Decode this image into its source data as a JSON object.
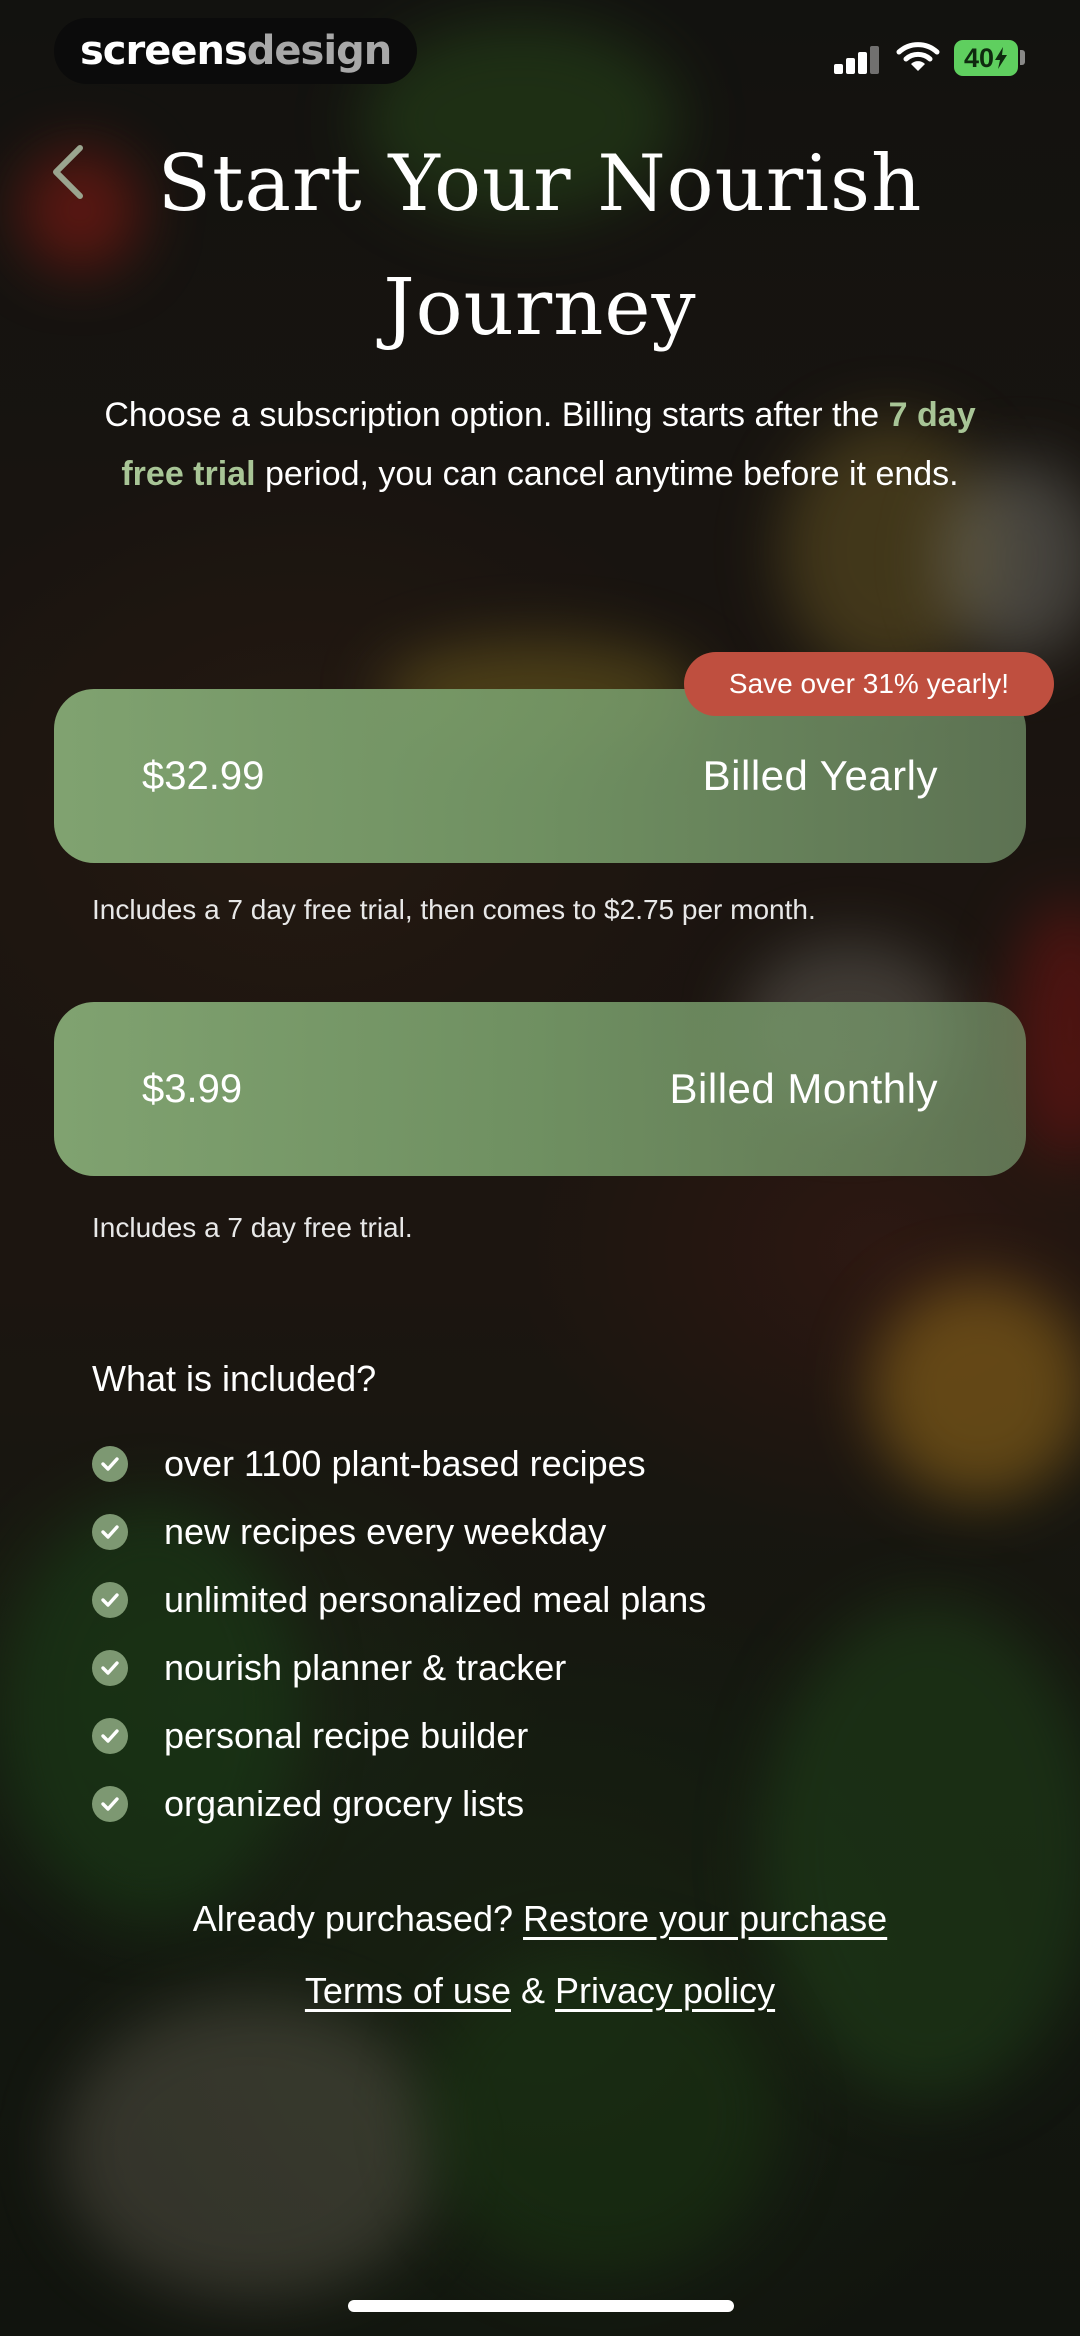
{
  "status_bar": {
    "brand_part1": "screens",
    "brand_part2": "design",
    "battery": "40"
  },
  "header": {
    "back_icon": "chevron-left-icon",
    "title": "Start Your Nourish Journey"
  },
  "subtitle": {
    "before": "Choose a subscription option. Billing starts after the ",
    "highlight": "7 day free trial",
    "after": " period, you can cancel anytime before it ends."
  },
  "plans": [
    {
      "price": "$32.99",
      "period": "Billed Yearly",
      "badge": "Save over 31% yearly!",
      "note": "Includes a 7 day free trial, then comes to $2.75 per month."
    },
    {
      "price": "$3.99",
      "period": "Billed Monthly",
      "note": "Includes a 7 day free trial."
    }
  ],
  "included": {
    "heading": "What is included?",
    "check_icon": "check-circle-icon",
    "items": [
      "over 1100 plant-based recipes",
      "new recipes every weekday",
      "unlimited personalized meal plans",
      "nourish planner & tracker",
      "personal recipe builder",
      "organized grocery lists"
    ]
  },
  "footer": {
    "restore_prompt": "Already purchased?",
    "restore_link": "Restore your purchase",
    "terms_link": "Terms of use",
    "separator": "&",
    "privacy_link": "Privacy policy"
  },
  "colors": {
    "accent_green": "#a8c596",
    "plan_green": "#84a874",
    "badge_red": "#bf4f3f"
  }
}
